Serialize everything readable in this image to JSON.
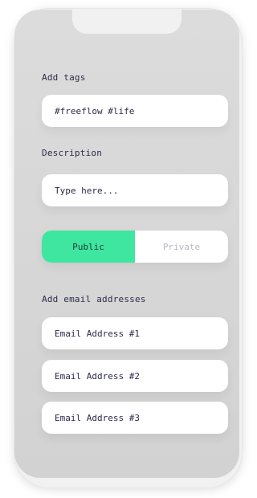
{
  "form": {
    "tags": {
      "label": "Add tags",
      "value": "#freeflow #life"
    },
    "description": {
      "label": "Description",
      "placeholder": "Type here..."
    },
    "visibility": {
      "public_label": "Public",
      "private_label": "Private",
      "selected": "Public"
    },
    "email": {
      "label": "Add email addresses",
      "fields": [
        "Email Address #1",
        "Email Address #2",
        "Email Address #3"
      ]
    }
  },
  "colors": {
    "accent": "#3ee6a0",
    "text": "#2b2b4a",
    "muted": "#b7b7c2"
  }
}
